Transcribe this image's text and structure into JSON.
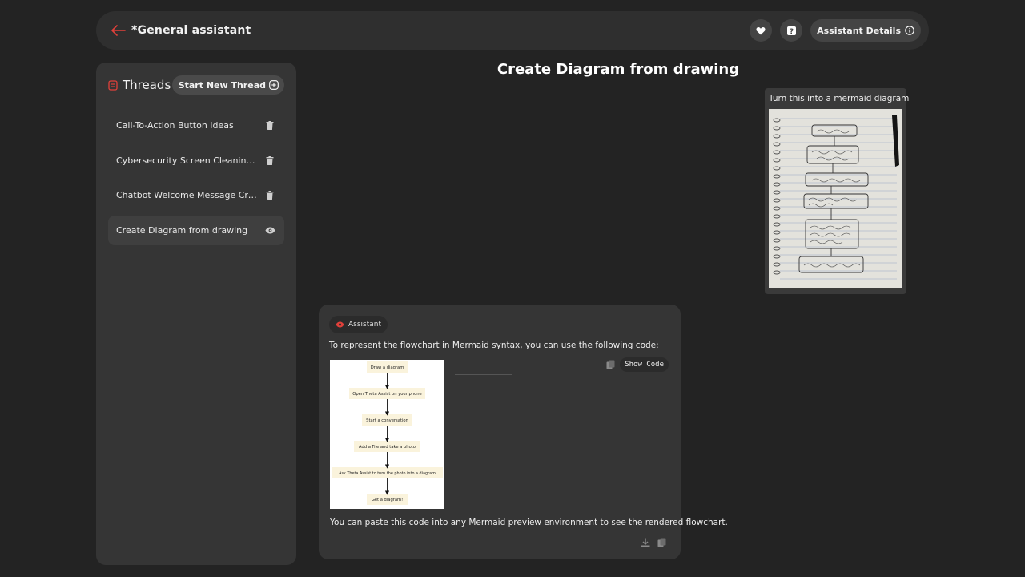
{
  "header": {
    "title": "*General assistant",
    "details_label": "Assistant Details",
    "accent": "#e0403a"
  },
  "sidebar": {
    "title": "Threads",
    "new_thread_label": "Start New Thread",
    "threads": [
      {
        "label": "Call-To-Action Button Ideas",
        "action": "trash-icon"
      },
      {
        "label": "Cybersecurity Screen Cleaning Methods",
        "action": "trash-icon"
      },
      {
        "label": "Chatbot Welcome Message Creation",
        "action": "trash-icon"
      },
      {
        "label": "Create Diagram from drawing",
        "action": "eye-icon",
        "active": true
      }
    ]
  },
  "conversation": {
    "title": "Create Diagram from drawing",
    "user_message": {
      "text": "Turn this into a mermaid diagram",
      "image": "photo-of-handwritten-flowchart"
    },
    "assistant_message": {
      "author": "Assistant",
      "intro": "To represent the flowchart in Mermaid syntax, you can use the following code:",
      "show_code_label": "Show Code",
      "diagram_nodes": [
        "Draw a diagram",
        "Open Theta Assist on your phone",
        "Start a conversation",
        "Add a File and take a photo",
        "Ask Theta Assist to turn the photo into a diagram",
        "Get a diagram!"
      ],
      "outro": "You can paste this code into any Mermaid preview environment to see the rendered flowchart."
    }
  }
}
